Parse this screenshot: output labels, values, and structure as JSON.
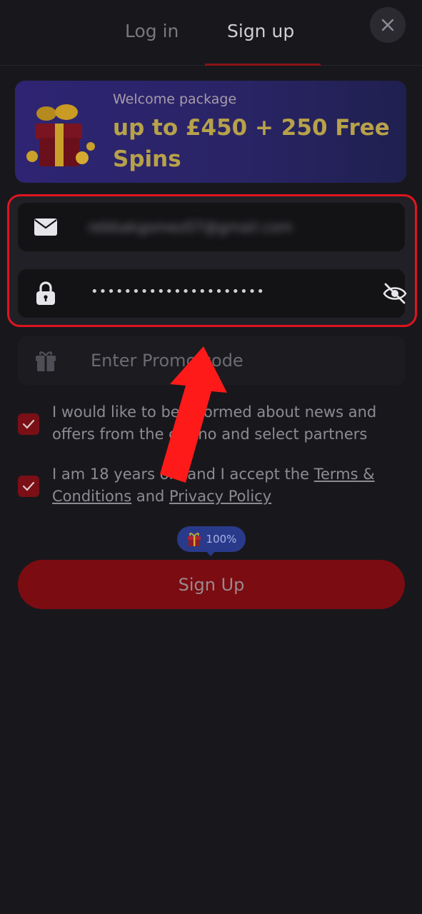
{
  "tabs": {
    "login_label": "Log in",
    "signup_label": "Sign up",
    "active": "Sign up"
  },
  "close": {
    "icon": "close-icon"
  },
  "banner": {
    "kicker": "Welcome package",
    "title": "up to £450 + 250 Free Spins",
    "icon": "gift-coins-icon",
    "colors": {
      "title": "#b7a24a",
      "background": "#2e2473"
    }
  },
  "form": {
    "email": {
      "icon": "mail-icon",
      "value": "rebbakgomez07@gmail.com"
    },
    "password": {
      "icon": "lock-icon",
      "value": "•••••••••••••••••••••",
      "toggle_icon": "eye-off-icon"
    },
    "promo": {
      "icon": "gift-icon",
      "placeholder": "Enter Promo code"
    }
  },
  "checks": [
    {
      "checked": true,
      "label": "I would like to be informed about news and offers from the casino and select partners"
    },
    {
      "checked": true,
      "label_prefix": "I am 18 years old and I accept the ",
      "terms_link": "Terms & Conditions",
      "label_mid": " and ",
      "privacy_link": "Privacy Policy"
    }
  ],
  "badge": {
    "text": "100%",
    "icon": "gift-icon"
  },
  "submit": {
    "label": "Sign Up"
  },
  "annotation": {
    "highlight_color": "#e0141f",
    "arrow_color": "#ff1a1a"
  }
}
